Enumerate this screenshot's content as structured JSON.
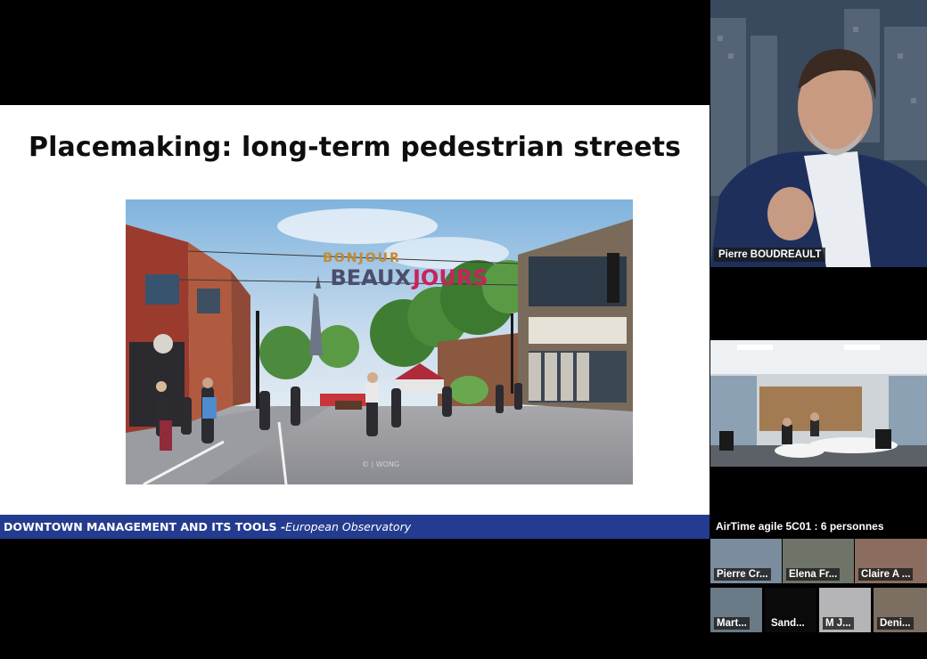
{
  "slide": {
    "title": "Placemaking: long-term pedestrian streets",
    "sign_top": "BONJOUR",
    "sign_main_left": "BEAUX",
    "sign_main_right": "JOURS",
    "photo_credit": "© | WONG",
    "footer_main": "DOWNTOWN MANAGEMENT AND ITS TOOLS - ",
    "footer_sub": "European Observatory"
  },
  "speaker": {
    "name": "Pierre BOUDREAULT"
  },
  "room": {
    "label": "AirTime agile 5C01 : 6 personnes"
  },
  "participants": [
    {
      "name": "Pierre Cr..."
    },
    {
      "name": "Elena Fr..."
    },
    {
      "name": "Claire A ..."
    },
    {
      "name": "Mart..."
    },
    {
      "name": "Sand..."
    },
    {
      "name": "M J..."
    },
    {
      "name": "Deni..."
    }
  ],
  "colors": {
    "footer_bar": "#243c8f",
    "sign_accent": "#c8235c",
    "sign_text": "#4a4e6b"
  }
}
